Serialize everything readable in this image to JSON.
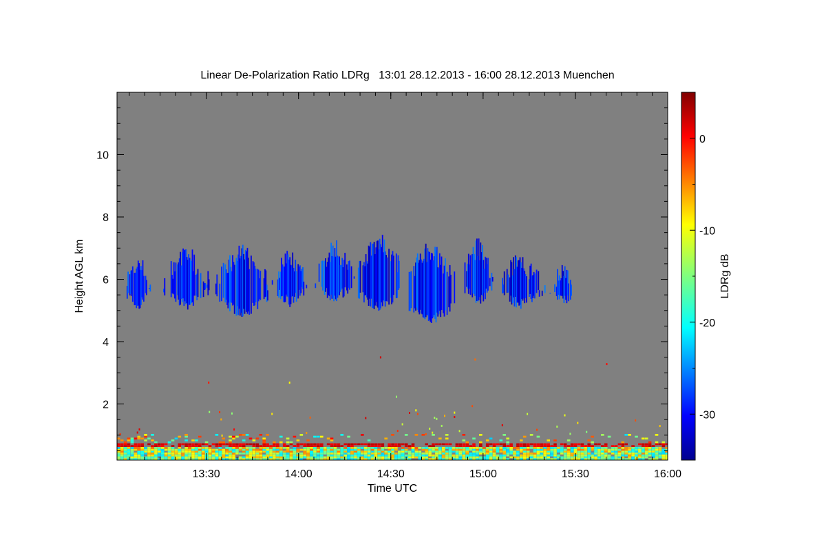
{
  "chart_data": {
    "type": "heatmap",
    "title": "Linear De-Polarization Ratio LDRg   13:01 28.12.2013 - 16:00 28.12.2013 Muenchen",
    "xlabel": "Time UTC",
    "ylabel": "Height AGL km",
    "colorbar_label": "LDRg dB",
    "x_range": [
      "13:01",
      "16:00"
    ],
    "y_range_km": [
      0.2,
      12.0
    ],
    "x_ticks": [
      "13:30",
      "14:00",
      "14:30",
      "15:00",
      "15:30",
      "16:00"
    ],
    "x_tick_minutes": [
      29,
      59,
      89,
      119,
      149,
      179
    ],
    "y_ticks": [
      2,
      4,
      6,
      8,
      10
    ],
    "colorbar_range_db": [
      -35,
      5
    ],
    "colorbar_ticks": [
      0,
      -10,
      -20,
      -30
    ],
    "background_color": "#808080",
    "cloud_layer": {
      "ldr_db_range": [
        -33,
        -25
      ],
      "segments": [
        {
          "t_start": 1,
          "t_end": 12,
          "base_km": 5.2,
          "top_km": 6.9
        },
        {
          "t_start": 15,
          "t_end": 30,
          "base_km": 5.2,
          "top_km": 7.2
        },
        {
          "t_start": 32,
          "t_end": 49,
          "base_km": 4.9,
          "top_km": 7.2
        },
        {
          "t_start": 50,
          "t_end": 62,
          "base_km": 5.3,
          "top_km": 7.1
        },
        {
          "t_start": 64,
          "t_end": 77,
          "base_km": 5.4,
          "top_km": 7.4
        },
        {
          "t_start": 78,
          "t_end": 92,
          "base_km": 5.1,
          "top_km": 7.6
        },
        {
          "t_start": 93,
          "t_end": 110,
          "base_km": 4.7,
          "top_km": 7.3
        },
        {
          "t_start": 112,
          "t_end": 122,
          "base_km": 5.3,
          "top_km": 7.4
        },
        {
          "t_start": 123,
          "t_end": 139,
          "base_km": 5.2,
          "top_km": 7.0
        },
        {
          "t_start": 140,
          "t_end": 150,
          "base_km": 5.3,
          "top_km": 6.7
        }
      ]
    },
    "boundary_layer": {
      "height_km": [
        0.2,
        1.0
      ],
      "ldr_db_range": [
        -22,
        2
      ]
    }
  }
}
